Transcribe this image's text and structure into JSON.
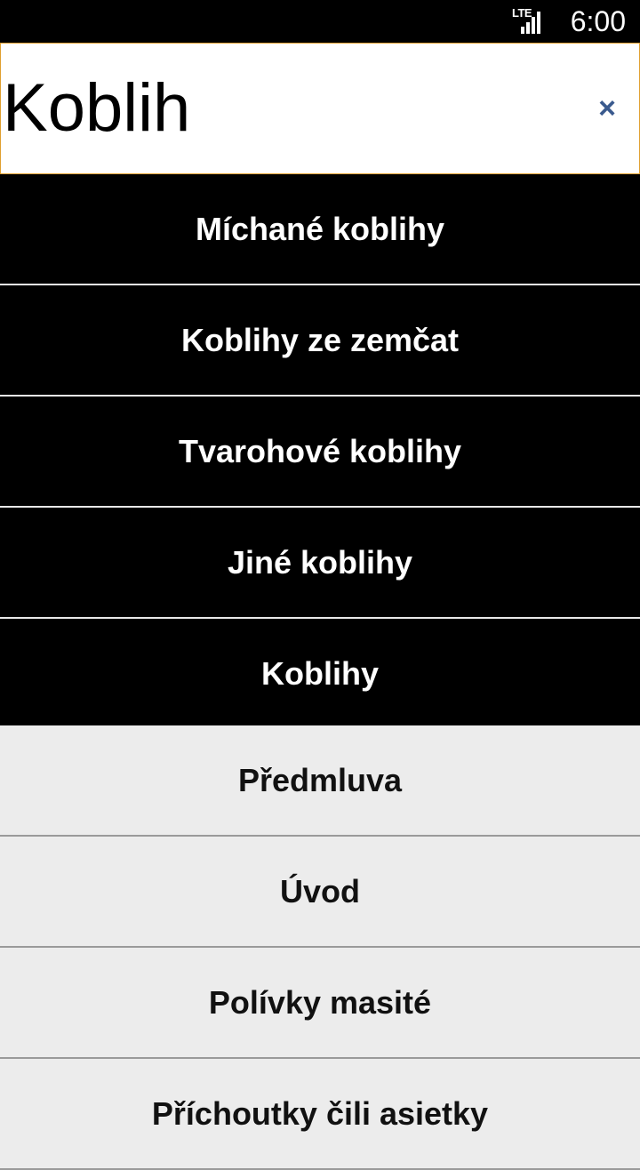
{
  "status_bar": {
    "network": "LTE",
    "time": "6:00"
  },
  "search": {
    "value": "Koblih",
    "clear_icon": "×"
  },
  "results": [
    {
      "label": "Míchané koblihy"
    },
    {
      "label": "Koblihy ze zemčat"
    },
    {
      "label": "Tvarohové koblihy"
    },
    {
      "label": "Jiné koblihy"
    },
    {
      "label": "Koblihy"
    }
  ],
  "chapters": [
    {
      "label": "Předmluva"
    },
    {
      "label": "Úvod"
    },
    {
      "label": "Polívky masité"
    },
    {
      "label": "Příchoutky čili asietky"
    }
  ]
}
